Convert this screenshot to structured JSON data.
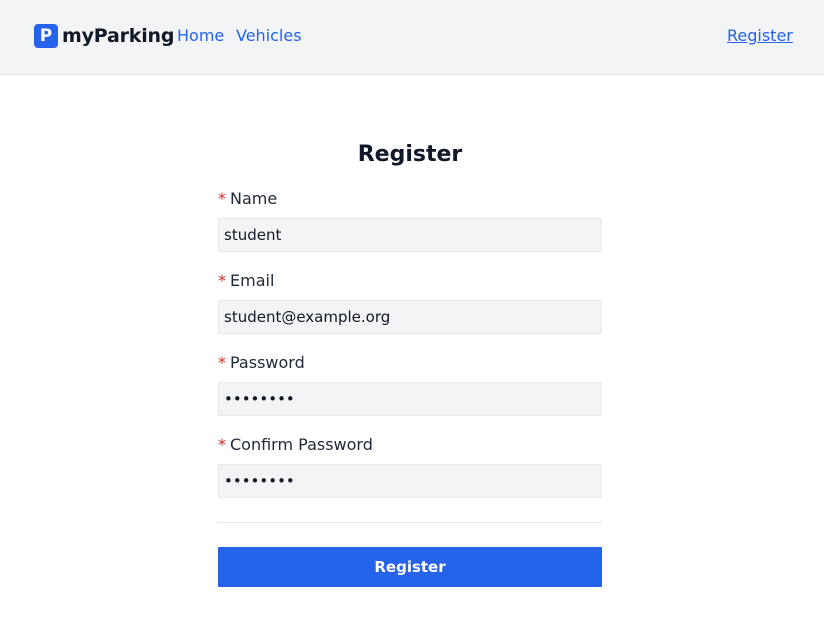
{
  "header": {
    "logo_letter": "P",
    "brand": "myParking",
    "nav": {
      "home": "Home",
      "vehicles": "Vehicles",
      "register": "Register"
    }
  },
  "form": {
    "title": "Register",
    "required_mark": "*",
    "fields": {
      "name": {
        "label": "Name",
        "value": "student"
      },
      "email": {
        "label": "Email",
        "value": "student@example.org"
      },
      "password": {
        "label": "Password",
        "value": "••••••••"
      },
      "confirm_password": {
        "label": "Confirm Password",
        "value": "••••••••"
      }
    },
    "submit_label": "Register"
  },
  "colors": {
    "accent": "#2563eb",
    "required": "#dc2626",
    "input_bg": "#f3f4f6"
  }
}
